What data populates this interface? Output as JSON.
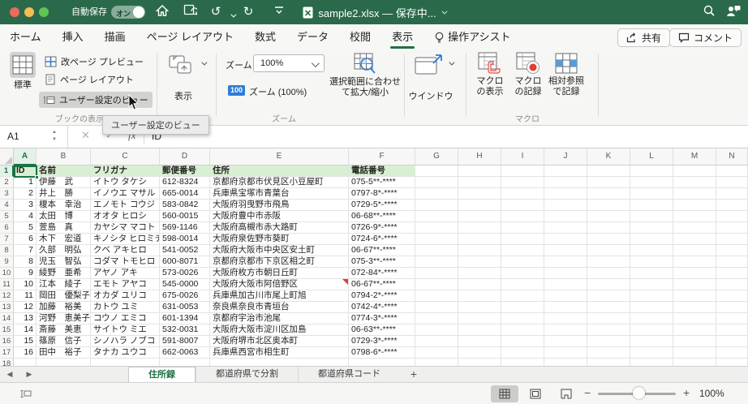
{
  "window": {
    "autosave_label": "自動保存",
    "autosave_state": "オン",
    "title": "sample2.xlsx — 保存中...",
    "accent_green": "#217346"
  },
  "ribbon_tabs": {
    "items": [
      "ホーム",
      "挿入",
      "描画",
      "ページ レイアウト",
      "数式",
      "データ",
      "校閲",
      "表示"
    ],
    "active": "表示",
    "assistant_label": "操作アシスト",
    "share_label": "共有",
    "comment_label": "コメント"
  },
  "ribbon": {
    "book_view_group": {
      "normal_label": "標準",
      "page_break_preview_label": "改ページ プレビュー",
      "page_layout_label": "ページ レイアウト",
      "custom_views_label": "ユーザー設定のビュー",
      "group_label": "ブックの表示"
    },
    "show_group": {
      "show_label": "表示"
    },
    "zoom_group": {
      "zoom_label": "ズーム",
      "zoom_value": "100%",
      "zoom_100_badge": "100",
      "zoom_100_label": "ズーム (100%)",
      "fit_selection_line1": "選択範囲に合わせ",
      "fit_selection_line2": "て拡大/縮小",
      "group_label": "ズーム"
    },
    "window_group": {
      "window_label": "ウインドウ"
    },
    "macro_group": {
      "show_macro_line1": "マクロ",
      "show_macro_line2": "の表示",
      "record_macro_line1": "マクロ",
      "record_macro_line2": "の記録",
      "relative_ref_line1": "相対参照",
      "relative_ref_line2": "で記録",
      "group_label": "マクロ"
    },
    "tooltip": "ユーザー設定のビュー"
  },
  "formula_bar": {
    "name_box": "A1",
    "fx_label": "fx",
    "value": "ID"
  },
  "grid": {
    "column_letters": [
      "A",
      "B",
      "C",
      "D",
      "E",
      "F",
      "G",
      "H",
      "I",
      "J",
      "K",
      "L",
      "M",
      "N"
    ],
    "selected_cell": "A1",
    "header_row": [
      "ID",
      "名前",
      "フリガナ",
      "郵便番号",
      "住所",
      "電話番号"
    ],
    "rows": [
      [
        "1",
        "伊藤　武",
        "イトウ タケシ",
        "612-8324",
        "京都府京都市伏見区小豆屋町",
        "075-5**-****"
      ],
      [
        "2",
        "井上　勝",
        "イノウエ マサル",
        "665-0014",
        "兵庫県宝塚市青葉台",
        "0797-8*-****"
      ],
      [
        "3",
        "榎本　幸治",
        "エノモト コウジ",
        "583-0842",
        "大阪府羽曳野市飛鳥",
        "0729-5*-****"
      ],
      [
        "4",
        "太田　博",
        "オオタ ヒロシ",
        "560-0015",
        "大阪府豊中市赤阪",
        "06-68**-****"
      ],
      [
        "5",
        "萱島　真",
        "カヤシマ マコト",
        "569-1146",
        "大阪府高槻市赤大路町",
        "0726-9*-****"
      ],
      [
        "6",
        "木下　宏道",
        "キノシタ ヒロミチ",
        "598-0014",
        "大阪府泉佐野市葵町",
        "0724-6*-****"
      ],
      [
        "7",
        "久部　明弘",
        "クベ アキヒロ",
        "541-0052",
        "大阪府大阪市中央区安土町",
        "06-67**-****"
      ],
      [
        "8",
        "児玉　智弘",
        "コダマ トモヒロ",
        "600-8071",
        "京都府京都市下京区相之町",
        "075-3**-****"
      ],
      [
        "9",
        "綾野　亜希",
        "アヤノ アキ",
        "573-0026",
        "大阪府枚方市朝日丘町",
        "072-84*-****"
      ],
      [
        "10",
        "江本　綾子",
        "エモト アヤコ",
        "545-0000",
        "大阪府大阪市阿倍野区",
        "06-67**-****"
      ],
      [
        "11",
        "岡田　優梨子",
        "オカダ ユリコ",
        "675-0026",
        "兵庫県加古川市尾上町旭",
        "0794-2*-****"
      ],
      [
        "12",
        "加藤　裕美",
        "カトウ ユミ",
        "631-0053",
        "奈良県奈良市青垣台",
        "0742-4*-****"
      ],
      [
        "13",
        "河野　恵美子",
        "コウノ エミコ",
        "601-1394",
        "京都府宇治市池尾",
        "0774-3*-****"
      ],
      [
        "14",
        "斎藤　美恵",
        "サイトウ ミエ",
        "532-0031",
        "大阪府大阪市淀川区加島",
        "06-63**-****"
      ],
      [
        "15",
        "篠原　信子",
        "シノハラ ノブコ",
        "591-8007",
        "大阪府堺市北区奥本町",
        "0729-3*-****"
      ],
      [
        "16",
        "田中　裕子",
        "タナカ ユウコ",
        "662-0063",
        "兵庫県西宮市相生町",
        "0798-6*-****"
      ]
    ],
    "comment_marker_cell": "E11"
  },
  "sheet_tabs": {
    "tabs": [
      "住所録",
      "都道府県で分割",
      "都道府県コード"
    ],
    "active": "住所録",
    "add_label": "+"
  },
  "status_bar": {
    "zoom_percent": "100%"
  }
}
